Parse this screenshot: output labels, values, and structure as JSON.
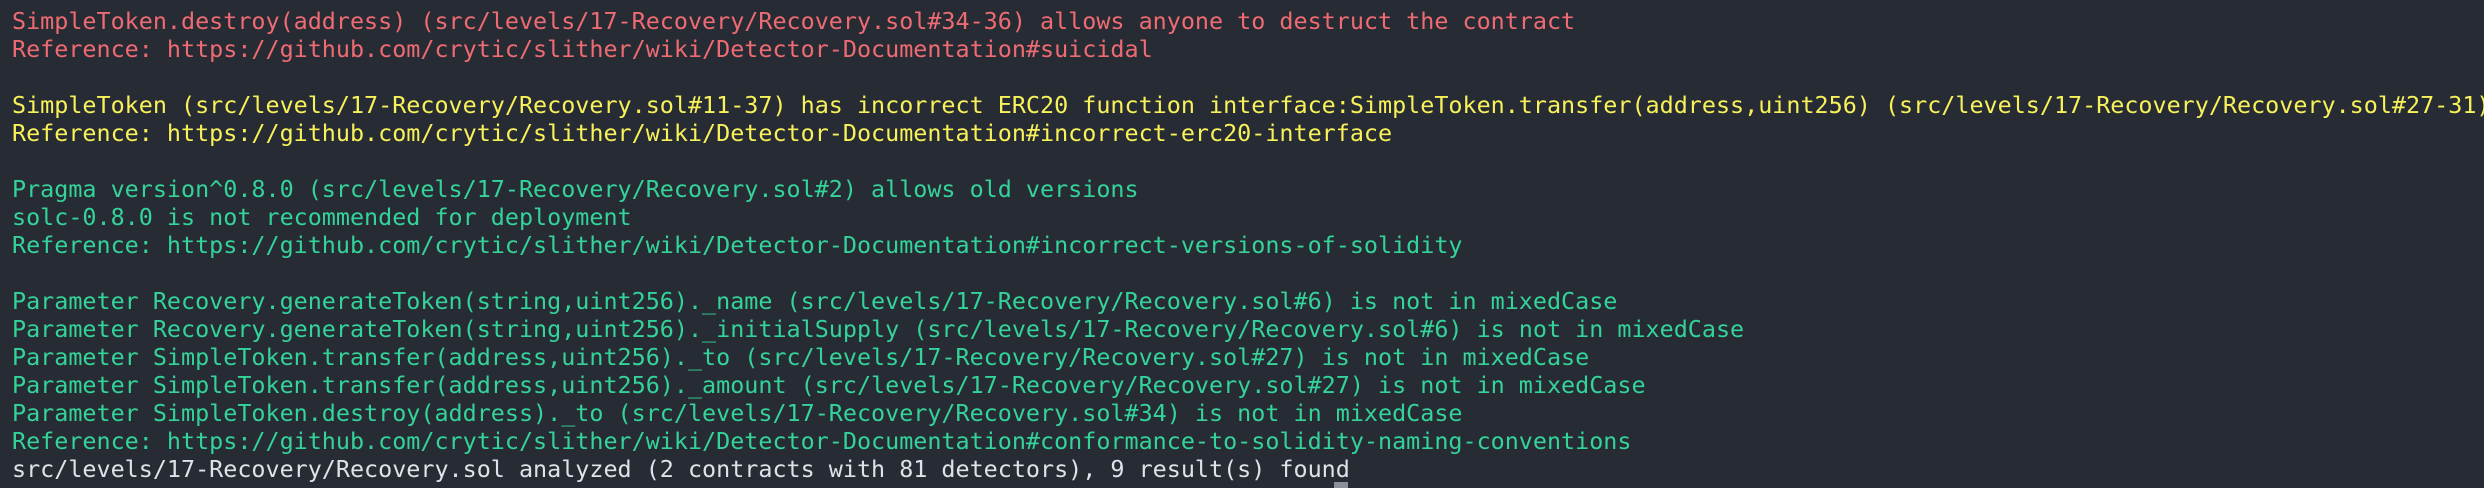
{
  "terminal": {
    "colors": {
      "background": "#272b33",
      "high_severity": "#ee6b73",
      "medium_severity": "#f7f15a",
      "informational": "#34d39a",
      "plain": "#dfe2e8"
    },
    "lines": [
      "SimpleToken.destroy(address) (src/levels/17-Recovery/Recovery.sol#34-36) allows anyone to destruct the contract",
      "Reference: https://github.com/crytic/slither/wiki/Detector-Documentation#suicidal",
      "SimpleToken (src/levels/17-Recovery/Recovery.sol#11-37) has incorrect ERC20 function interface:SimpleToken.transfer(address,uint256) (src/levels/17-Recovery/Recovery.sol#27-31)",
      "Reference: https://github.com/crytic/slither/wiki/Detector-Documentation#incorrect-erc20-interface",
      "Pragma version^0.8.0 (src/levels/17-Recovery/Recovery.sol#2) allows old versions",
      "solc-0.8.0 is not recommended for deployment",
      "Reference: https://github.com/crytic/slither/wiki/Detector-Documentation#incorrect-versions-of-solidity",
      "Parameter Recovery.generateToken(string,uint256)._name (src/levels/17-Recovery/Recovery.sol#6) is not in mixedCase",
      "Parameter Recovery.generateToken(string,uint256)._initialSupply (src/levels/17-Recovery/Recovery.sol#6) is not in mixedCase",
      "Parameter SimpleToken.transfer(address,uint256)._to (src/levels/17-Recovery/Recovery.sol#27) is not in mixedCase",
      "Parameter SimpleToken.transfer(address,uint256)._amount (src/levels/17-Recovery/Recovery.sol#27) is not in mixedCase",
      "Parameter SimpleToken.destroy(address)._to (src/levels/17-Recovery/Recovery.sol#34) is not in mixedCase",
      "Reference: https://github.com/crytic/slither/wiki/Detector-Documentation#conformance-to-solidity-naming-conventions",
      "src/levels/17-Recovery/Recovery.sol analyzed (2 contracts with 81 detectors), 9 result(s) found"
    ]
  }
}
